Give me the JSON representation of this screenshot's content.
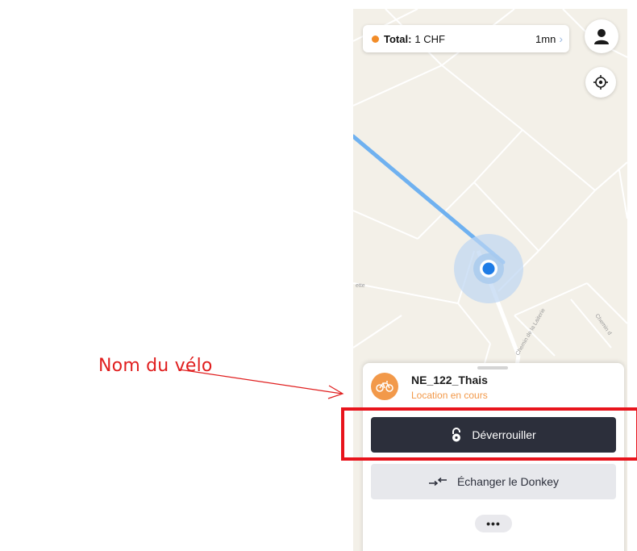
{
  "annotation": {
    "label": "Nom du vélo",
    "color": "#e01e1e"
  },
  "top_bar": {
    "total_label": "Total:",
    "total_amount": "1 CHF",
    "duration": "1mn",
    "chevron_icon": "chevron-right-icon",
    "status_dot_color": "#f28c28",
    "profile_icon": "user-icon",
    "locate_icon": "crosshair-icon"
  },
  "bike_card": {
    "name": "NE_122_Thais",
    "status": "Location en cours",
    "icon": "bicycle-icon",
    "accent_color": "#f2994a"
  },
  "actions": {
    "unlock_label": "Déverrouiller",
    "unlock_icon": "unlock-icon",
    "swap_label": "Échanger le Donkey",
    "swap_icon": "swap-arrows-icon",
    "more_label": "•••"
  },
  "map": {
    "street_labels": [
      "ette",
      "Chemin de la Laiterie",
      "Chemin d"
    ],
    "route_color": "#6fb1f0",
    "location_color": "#1e7ce6"
  },
  "highlight_color": "#e8141c"
}
